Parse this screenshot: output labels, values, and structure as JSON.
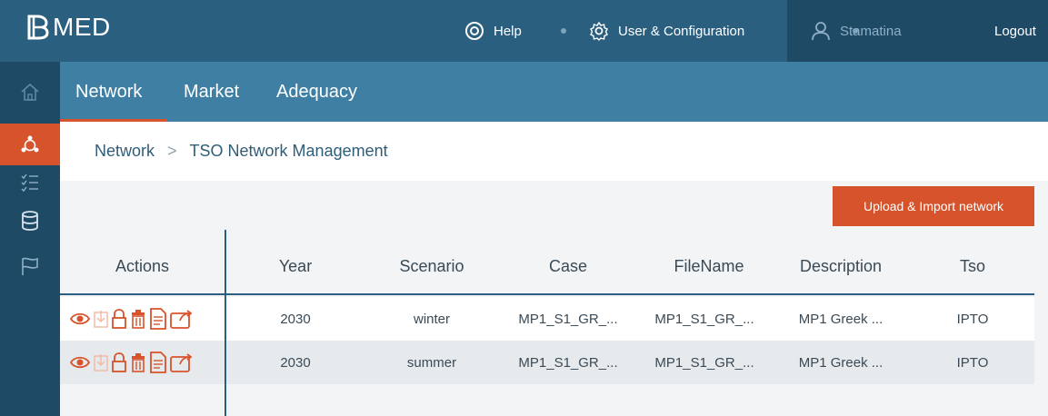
{
  "app": {
    "logo_text": "MED"
  },
  "topbar": {
    "help_label": "Help",
    "config_label": "User & Configuration",
    "user_name": "Stamatina",
    "logout_label": "Logout"
  },
  "nav": {
    "tabs": [
      {
        "label": "Network"
      },
      {
        "label": "Market"
      },
      {
        "label": "Adequacy"
      }
    ]
  },
  "breadcrumb": {
    "root": "Network",
    "separator": ">",
    "current": "TSO Network Management"
  },
  "toolbar": {
    "upload_label": "Upload & Import network"
  },
  "table": {
    "columns": [
      "Actions",
      "Year",
      "Scenario",
      "Case",
      "FileName",
      "Description",
      "Tso"
    ],
    "rows": [
      {
        "year": "2030",
        "scenario": "winter",
        "case": "MP1_S1_GR_...",
        "filename": "MP1_S1_GR_...",
        "description": "MP1 Greek ...",
        "tso": "IPTO"
      },
      {
        "year": "2030",
        "scenario": "summer",
        "case": "MP1_S1_GR_...",
        "filename": "MP1_S1_GR_...",
        "description": "MP1 Greek ...",
        "tso": "IPTO"
      }
    ]
  },
  "colors": {
    "topbar": "#2b5f80",
    "sidebar": "#1f4a66",
    "tabs": "#3f7fa4",
    "accent": "#d7532b"
  },
  "icons": {
    "sidebar": [
      "home-icon",
      "network-icon",
      "checklist-icon",
      "database-icon",
      "flag-icon"
    ],
    "row_actions": [
      "view-icon",
      "download-icon",
      "lock-icon",
      "delete-icon",
      "document-icon",
      "export-icon"
    ]
  }
}
